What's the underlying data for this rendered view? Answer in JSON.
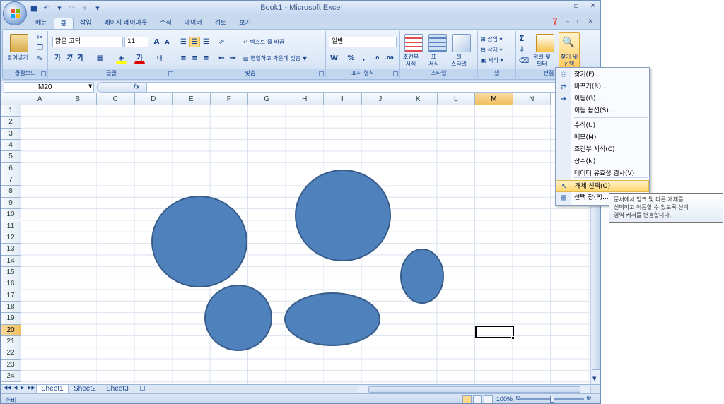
{
  "window": {
    "title": "Book1 - Microsoft Excel"
  },
  "qat": {
    "save_icon": "save-icon",
    "undo_icon": "undo-icon",
    "redo_icon": "redo-icon"
  },
  "tabs": [
    "메뉴",
    "홈",
    "삽입",
    "페이지 레이아웃",
    "수식",
    "데이터",
    "검토",
    "보기"
  ],
  "active_tab": "홈",
  "ribbon": {
    "clipboard": {
      "label": "클립보드",
      "paste": "붙여넣기"
    },
    "font": {
      "label": "글꼴",
      "font_name": "맑은 고딕",
      "font_size": "11"
    },
    "alignment": {
      "label": "맞춤",
      "wrap_text": "텍스트 줄 바꿈",
      "merge_center": "병합하고 가운데 맞춤"
    },
    "number": {
      "label": "표시 형식",
      "format": "일반"
    },
    "styles": {
      "label": "스타일",
      "conditional": "조건부\n서식",
      "table": "표\n서식",
      "cell": "셀\n스타일"
    },
    "cells": {
      "label": "셀",
      "insert": "삽입",
      "delete": "삭제",
      "format": "서식"
    },
    "editing": {
      "label": "편집",
      "sort_filter": "정렬 및\n필터",
      "find_select": "찾기 및\n선택"
    }
  },
  "formula_bar": {
    "name_box": "M20",
    "fx": "fx",
    "formula": ""
  },
  "columns": [
    "A",
    "B",
    "C",
    "D",
    "E",
    "F",
    "G",
    "H",
    "I",
    "J",
    "K",
    "L",
    "M",
    "N"
  ],
  "rows": [
    "1",
    "2",
    "3",
    "4",
    "5",
    "6",
    "7",
    "8",
    "9",
    "10",
    "11",
    "12",
    "13",
    "14",
    "15",
    "16",
    "17",
    "18",
    "19",
    "20",
    "21",
    "22",
    "23",
    "24"
  ],
  "active_cell": {
    "col": "M",
    "row": "20"
  },
  "shape_color": "#4f81bd",
  "shape_border": "#385d8a",
  "find_select_menu": {
    "items": [
      {
        "label": "찾기(F)...",
        "icon": "binoculars-icon"
      },
      {
        "label": "바꾸기(R)...",
        "icon": "replace-icon"
      },
      {
        "label": "이동(G)...",
        "icon": "arrow-right-icon"
      },
      {
        "label": "이동 옵션(S)...",
        "icon": ""
      },
      {
        "label": "수식(U)",
        "icon": ""
      },
      {
        "label": "메모(M)",
        "icon": ""
      },
      {
        "label": "조건부 서식(C)",
        "icon": ""
      },
      {
        "label": "상수(N)",
        "icon": ""
      },
      {
        "label": "데이터 유효성 검사(V)",
        "icon": ""
      },
      {
        "label": "개체 선택(O)",
        "icon": "cursor-arrow-icon"
      },
      {
        "label": "선택 창(P)...",
        "icon": "selection-pane-icon"
      }
    ],
    "highlighted": "개체 선택(O)"
  },
  "tooltip": {
    "text": "문서에서 잉크 및 다른 개체를\n선택하고 이동할 수 있도록 선택\n영역 커서를 변경합니다."
  },
  "sheets": [
    "Sheet1",
    "Sheet2",
    "Sheet3"
  ],
  "active_sheet": "Sheet1",
  "status": {
    "text": "준비",
    "zoom": "100%"
  }
}
